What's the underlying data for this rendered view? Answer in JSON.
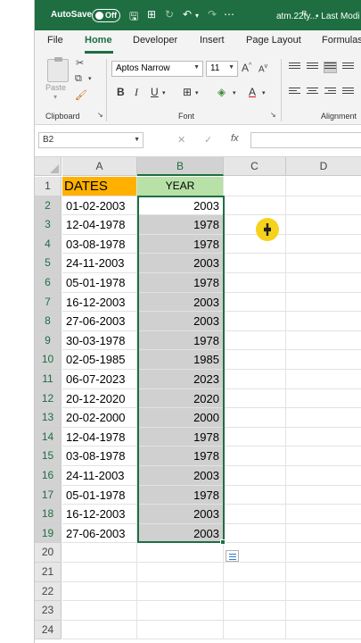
{
  "titlebar": {
    "autosave_label": "AutoSave",
    "toggle_state": "Off",
    "filename": "atm.22ty...",
    "modified": "• Last Modi"
  },
  "tabs": [
    "File",
    "Home",
    "Developer",
    "Insert",
    "Page Layout",
    "Formulas"
  ],
  "ribbon": {
    "paste_label": "Paste",
    "font_name": "Aptos Narrow",
    "font_size": "11",
    "bold": "B",
    "italic": "I",
    "underline": "U",
    "group_clipboard": "Clipboard",
    "group_font": "Font",
    "group_alignment": "Alignment",
    "grow_font": "A",
    "shrink_font": "A",
    "font_color": "A"
  },
  "formula_bar": {
    "name_box": "B2",
    "fx": "fx",
    "cancel": "✕",
    "enter": "✓"
  },
  "columns": [
    "A",
    "B",
    "C",
    "D"
  ],
  "rows": [
    {
      "n": "1",
      "a": "DATES",
      "b": "YEAR"
    },
    {
      "n": "2",
      "a": "01-02-2003",
      "b": "2003"
    },
    {
      "n": "3",
      "a": "12-04-1978",
      "b": "1978"
    },
    {
      "n": "4",
      "a": "03-08-1978",
      "b": "1978"
    },
    {
      "n": "5",
      "a": "24-11-2003",
      "b": "2003"
    },
    {
      "n": "6",
      "a": "05-01-1978",
      "b": "1978"
    },
    {
      "n": "7",
      "a": "16-12-2003",
      "b": "2003"
    },
    {
      "n": "8",
      "a": "27-06-2003",
      "b": "2003"
    },
    {
      "n": "9",
      "a": "30-03-1978",
      "b": "1978"
    },
    {
      "n": "10",
      "a": "02-05-1985",
      "b": "1985"
    },
    {
      "n": "11",
      "a": "06-07-2023",
      "b": "2023"
    },
    {
      "n": "12",
      "a": "20-12-2020",
      "b": "2020"
    },
    {
      "n": "13",
      "a": "20-02-2000",
      "b": "2000"
    },
    {
      "n": "14",
      "a": "12-04-1978",
      "b": "1978"
    },
    {
      "n": "15",
      "a": "03-08-1978",
      "b": "1978"
    },
    {
      "n": "16",
      "a": "24-11-2003",
      "b": "2003"
    },
    {
      "n": "17",
      "a": "05-01-1978",
      "b": "1978"
    },
    {
      "n": "18",
      "a": "16-12-2003",
      "b": "2003"
    },
    {
      "n": "19",
      "a": "27-06-2003",
      "b": "2003"
    },
    {
      "n": "20",
      "a": "",
      "b": ""
    },
    {
      "n": "21",
      "a": "",
      "b": ""
    },
    {
      "n": "22",
      "a": "",
      "b": ""
    },
    {
      "n": "23",
      "a": "",
      "b": ""
    },
    {
      "n": "24",
      "a": "",
      "b": ""
    }
  ],
  "colors": {
    "brand_green": "#1e6e42",
    "header_a1": "#ffb000",
    "header_b1": "#b7e1a6",
    "selection": "#d0d0d0",
    "cursor_highlight": "#f6d21b"
  },
  "icons": {
    "save": "save-icon",
    "undo": "undo-icon",
    "redo": "redo-icon",
    "cut": "scissors-icon",
    "copy": "copy-icon",
    "format_painter": "format-painter-icon",
    "borders": "borders-icon",
    "fill_color": "fill-color-icon",
    "quick_analysis": "quick-analysis-icon"
  }
}
